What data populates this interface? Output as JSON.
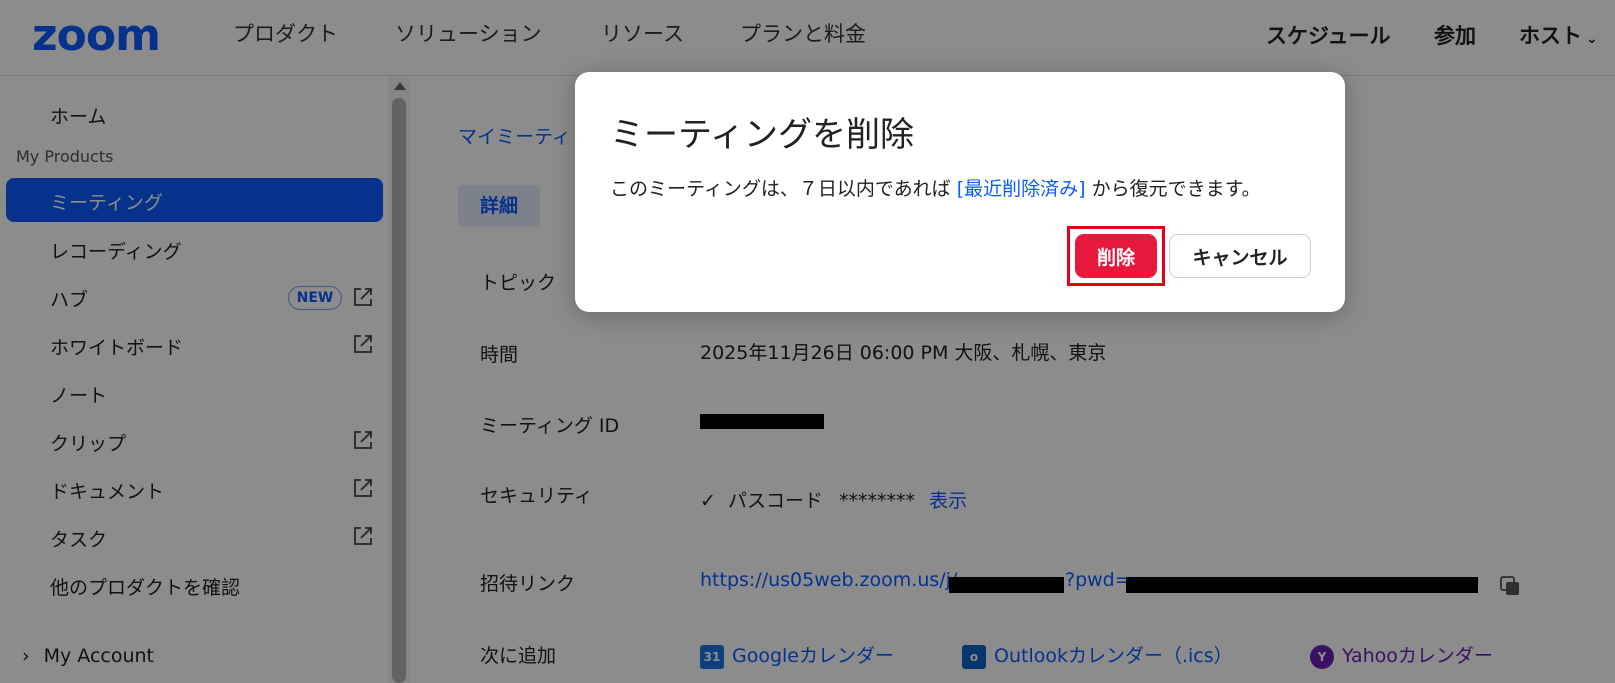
{
  "topnav": {
    "logo": "zoom",
    "items": [
      "プロダクト",
      "ソリューション",
      "リソース",
      "プランと料金"
    ],
    "right": [
      "スケジュール",
      "参加",
      "ホスト"
    ]
  },
  "sidebar": {
    "home": "ホーム",
    "section": "My Products",
    "items": [
      {
        "label": "ミーティング",
        "active": true
      },
      {
        "label": "レコーディング"
      },
      {
        "label": "ハブ",
        "badge": "NEW"
      },
      {
        "label": "ホワイトボード"
      },
      {
        "label": "ノート"
      },
      {
        "label": "クリップ"
      },
      {
        "label": "ドキュメント"
      },
      {
        "label": "タスク"
      },
      {
        "label": "他のプロダクトを確認"
      }
    ],
    "account": "My Account"
  },
  "main": {
    "breadcrumb": "マイミーティ",
    "tab": "詳細",
    "rows": {
      "topic_label": "トピック",
      "time_label": "時間",
      "time_value": "2025年11月26日 06:00 PM 大阪、札幌、東京",
      "meeting_id_label": "ミーティング ID",
      "security_label": "セキュリティ",
      "passcode_check": "✓",
      "passcode_label": "パスコード",
      "passcode_mask": "********",
      "passcode_show": "表示",
      "invite_label": "招待リンク",
      "invite_link_prefix": "https://us05web.zoom.us/j/",
      "invite_link_mid": "?pwd=",
      "add_label": "次に追加",
      "google": "Googleカレンダー",
      "outlook": "Outlookカレンダー（.ics）",
      "yahoo": "Yahooカレンダー"
    }
  },
  "dialog": {
    "title": "ミーティングを削除",
    "body_before": "このミーティングは、７日以内であれば ",
    "body_link": "[最近削除済み]",
    "body_after": " から復元できます。",
    "delete": "削除",
    "cancel": "キャンセル"
  }
}
